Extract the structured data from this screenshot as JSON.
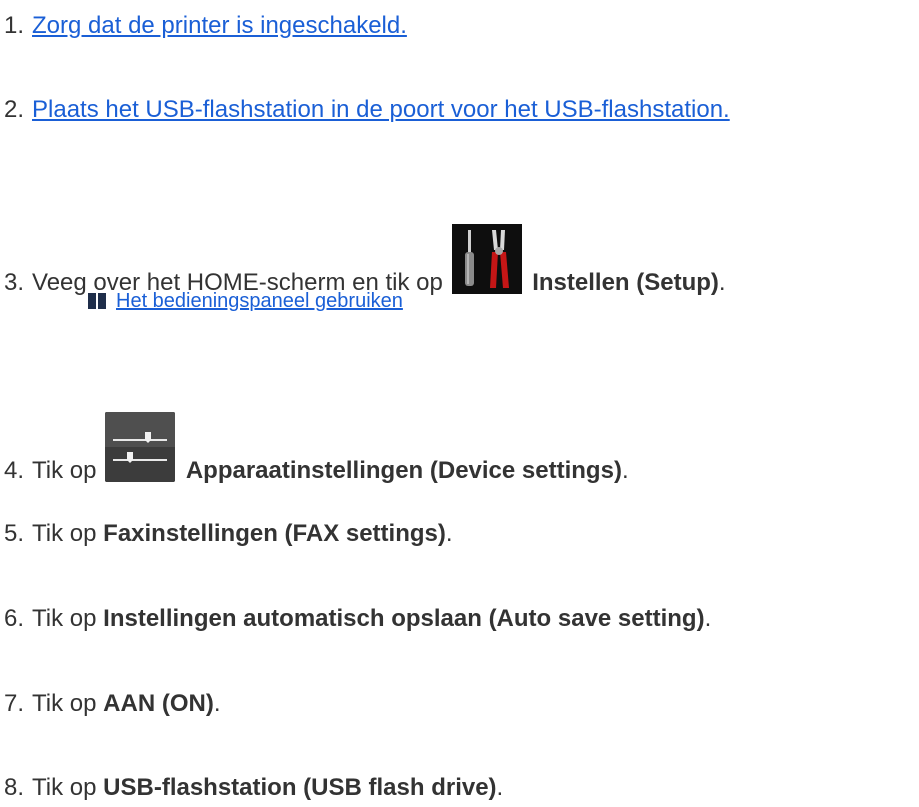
{
  "steps": [
    {
      "num": "1.",
      "link": "Zorg dat de printer is ingeschakeld."
    },
    {
      "num": "2.",
      "link": "Plaats het USB-flashstation in de poort voor het USB-flashstation."
    },
    {
      "num": "3.",
      "pre": "Veeg over het HOME-scherm en tik op",
      "bold": "Instellen (Setup)",
      "post": ".",
      "icon": "setup-icon"
    },
    {
      "num": "4.",
      "pre": "Tik op",
      "bold": "Apparaatinstellingen (Device settings)",
      "post": ".",
      "icon": "device-settings-icon"
    },
    {
      "num": "5.",
      "pre": "Tik op",
      "bold": "Faxinstellingen (FAX settings)",
      "post": "."
    },
    {
      "num": "6.",
      "pre": "Tik op",
      "bold": "Instellingen automatisch opslaan (Auto save setting)",
      "post": "."
    },
    {
      "num": "7.",
      "pre": "Tik op",
      "bold": "AAN (ON)",
      "post": "."
    },
    {
      "num": "8.",
      "pre": "Tik op",
      "bold": "USB-flashstation (USB flash drive)",
      "post": "."
    }
  ],
  "sub_link": "Het bedieningspaneel gebruiken",
  "colors": {
    "link": "#1a5fd6",
    "text": "#333333"
  }
}
